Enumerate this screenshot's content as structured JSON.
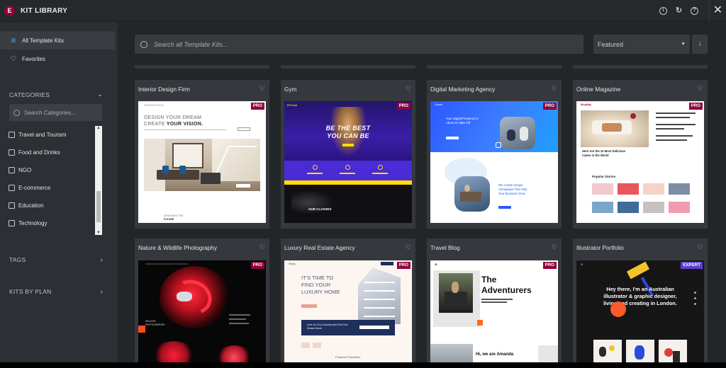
{
  "app": {
    "title": "KIT LIBRARY",
    "logo_letter": "E",
    "accent_color": "#92003b",
    "top_icons": [
      "info-icon",
      "sync-icon",
      "help-icon"
    ],
    "close_label": "✕"
  },
  "sidebar": {
    "nav": [
      {
        "label": "All Template Kits",
        "icon": "list-icon",
        "active": true
      },
      {
        "label": "Favorites",
        "icon": "heart-icon",
        "active": false
      }
    ],
    "categories_title": "CATEGORIES",
    "category_search_placeholder": "Search Categories...",
    "categories": [
      "Travel and Tourism",
      "Food and Drinks",
      "NGO",
      "E-commerce",
      "Education",
      "Technology"
    ],
    "tags_title": "TAGS",
    "plans_title": "KITS BY PLAN"
  },
  "main": {
    "search_placeholder": "Search all Template Kits...",
    "sort": {
      "selected": "Featured",
      "direction_icon": "arrow-down-icon"
    },
    "kits": [
      {
        "name": "Interior Design Firm",
        "badge": "PRO",
        "thumb_style": "interior",
        "texts": {
          "brand": "DESIGN STUDIO",
          "h1a": "DESIGN YOUR DREAM",
          "h1b": "CREATE ",
          "h1c": "YOUR VISION.",
          "foot1": "DESIGNING THE",
          "foot2": "FUTURE"
        }
      },
      {
        "name": "Gym",
        "badge": "PRO",
        "thumb_style": "gym",
        "texts": {
          "brand": "Fit Fuel",
          "h1a": "BE THE BEST",
          "h1b": "YOU CAN BE",
          "foot1": "OUR CLASSES"
        }
      },
      {
        "name": "Digital Marketing Agency",
        "badge": "PRO",
        "thumb_style": "digital",
        "texts": {
          "brand": "Growio",
          "h1a": "Your Digital Presence is",
          "h1b": "About To Take Off",
          "h2a": "We Create Unique",
          "h2b": "Campaigns That Help",
          "h2c": "Your Business Grow"
        }
      },
      {
        "name": "Online Magazine",
        "badge": "PRO",
        "thumb_style": "magazine",
        "texts": {
          "brand": "BlogMag",
          "h1a": "Here Are the 10 Most Delicious",
          "h1b": "Cakes in the World",
          "popular": "Popular Stories"
        }
      },
      {
        "name": "Nature & Wildlife Photography",
        "badge": "PRO",
        "thumb_style": "nature",
        "texts": {
          "h1a": "WILDLIFE",
          "h1b": "PHOTOGRAPHER"
        }
      },
      {
        "name": "Luxury Real Estate Agency",
        "badge": "PRO",
        "thumb_style": "realestate",
        "texts": {
          "brand": "Realty",
          "h1a": "IT'S TIME TO",
          "h1b": "FIND YOUR",
          "h1c": "LUXURY HOME",
          "box": "Let's Go On A Journey And Find Your Dream Home",
          "foot": "Featured Properties"
        }
      },
      {
        "name": "Travel Blog",
        "badge": "PRO",
        "thumb_style": "travel",
        "texts": {
          "brand": "A.",
          "h1a": "The",
          "h1b": "Adventurers",
          "foot": "Hi, we are Amanda"
        }
      },
      {
        "name": "Illustrator Portfolio",
        "badge": "EXPERT",
        "thumb_style": "illustrator",
        "texts": {
          "h1a": "Hey there, I'm an Australian",
          "h1b": "illustrator & graphic designer,",
          "h1c": "living and creating in London."
        }
      }
    ]
  }
}
